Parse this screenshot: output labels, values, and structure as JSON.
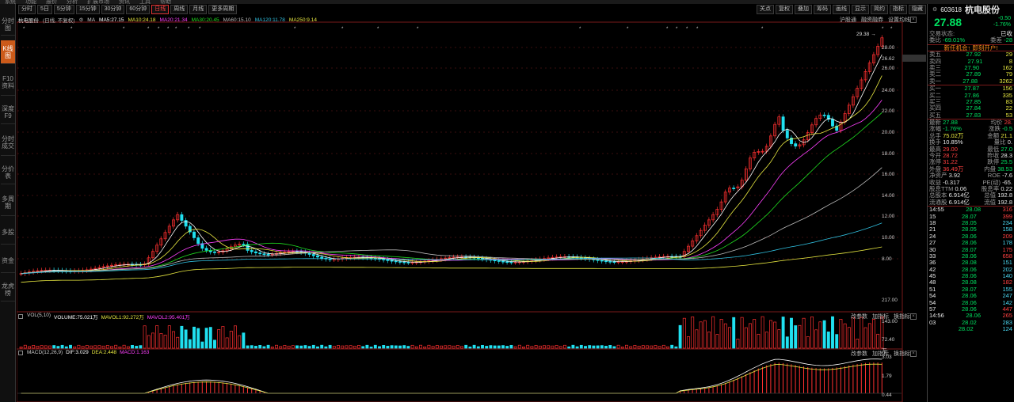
{
  "top_menu": [
    "系统",
    "功能",
    "报价",
    "分析",
    "扩展市场",
    "资讯",
    "工具",
    "帮助"
  ],
  "sidebar_tabs": [
    {
      "label": "分时图",
      "active": false
    },
    {
      "label": "K线图",
      "active": true
    },
    {
      "label": "F10资料",
      "active": false
    },
    {
      "label": "深度F9",
      "active": false
    },
    {
      "label": "分时成交",
      "active": false
    },
    {
      "label": "分价表",
      "active": false
    },
    {
      "label": "多周期",
      "active": false
    },
    {
      "label": "多股",
      "active": false
    },
    {
      "label": "资金",
      "active": false
    },
    {
      "label": "龙虎榜",
      "active": false
    }
  ],
  "toolbar": {
    "left": [
      {
        "label": "分时",
        "active": false
      },
      {
        "label": "5日",
        "active": false
      },
      {
        "label": "5分钟",
        "active": false
      },
      {
        "label": "15分钟",
        "active": false
      },
      {
        "label": "30分钟",
        "active": false
      },
      {
        "label": "60分钟",
        "active": false
      },
      {
        "label": "日线",
        "active": true
      },
      {
        "label": "周线",
        "active": false
      },
      {
        "label": "月线",
        "active": false
      },
      {
        "label": "更多周期",
        "active": false
      }
    ],
    "right": [
      "关点",
      "复权",
      "叠加",
      "筹码",
      "画线",
      "显示",
      "简约",
      "指标",
      "隐藏"
    ]
  },
  "main_panel": {
    "stock_label": "杭电股份",
    "period_note": "(日线, 不复权)",
    "legend": [
      {
        "text": "MA",
        "color": "#cccccc"
      },
      {
        "text": "MA5:27.15",
        "color": "#ffffff"
      },
      {
        "text": "MA10:24.18",
        "color": "#e8e840"
      },
      {
        "text": "MA20:21.34",
        "color": "#ff40ff"
      },
      {
        "text": "MA30:20.45",
        "color": "#20e020"
      },
      {
        "text": "MA60:15.10",
        "color": "#bbbbbb"
      },
      {
        "text": "MA120:11.78",
        "color": "#30c0e0"
      },
      {
        "text": "MA250:9.14",
        "color": "#e8e840"
      }
    ],
    "tools": [
      "沪股通",
      "融资融券",
      "设置均线"
    ],
    "max_label": "29.38",
    "price_ticks": [
      "28.00",
      "26.62",
      "26.00",
      "24.00",
      "22.00",
      "20.00",
      "18.00",
      "16.00",
      "14.00",
      "12.00",
      "10.00",
      "8.00"
    ]
  },
  "vol_panel": {
    "legend": [
      {
        "text": "VOL(5,10)",
        "color": "#cccccc"
      },
      {
        "text": "VOLUME:75.021万",
        "color": "#ffffff"
      },
      {
        "text": "MAVOL1:92.272万",
        "color": "#e8e840"
      },
      {
        "text": "MAVOL2:95.401万",
        "color": "#ff40ff"
      }
    ],
    "tools": [
      "改参数",
      "加指标",
      "换指标"
    ],
    "ticks": [
      "217.00",
      "143.00",
      "72.40",
      "万"
    ]
  },
  "macd_panel": {
    "legend": [
      {
        "text": "MACD(12,26,9)",
        "color": "#cccccc"
      },
      {
        "text": "DIF:3.029",
        "color": "#ffffff"
      },
      {
        "text": "DEA:2.448",
        "color": "#e8e840"
      },
      {
        "text": "MACD:1.163",
        "color": "#ff40ff"
      }
    ],
    "tools": [
      "改参数",
      "加指标",
      "换指标"
    ],
    "ticks": [
      "3.03",
      "1.79",
      "0.44"
    ]
  },
  "quote": {
    "code": "603618",
    "name": "杭电股份",
    "price": "27.88",
    "change": "-0.50",
    "change_pct": "-1.76%",
    "status_label": "交易状态:",
    "status_value": "已收",
    "webi_label": "委比",
    "webi_value": "-69.01%",
    "wecha_label": "委差",
    "wecha_value": "-28",
    "ad_text": "新任机会↑ 即刻开户!",
    "asks": [
      {
        "label": "卖五",
        "price": "27.92",
        "vol": "29"
      },
      {
        "label": "卖四",
        "price": "27.91",
        "vol": "8"
      },
      {
        "label": "卖三",
        "price": "27.90",
        "vol": "162"
      },
      {
        "label": "卖二",
        "price": "27.89",
        "vol": "79"
      },
      {
        "label": "卖一",
        "price": "27.88",
        "vol": "3262"
      }
    ],
    "bids": [
      {
        "label": "买一",
        "price": "27.87",
        "vol": "156"
      },
      {
        "label": "买二",
        "price": "27.86",
        "vol": "335"
      },
      {
        "label": "买三",
        "price": "27.85",
        "vol": "83"
      },
      {
        "label": "买四",
        "price": "27.84",
        "vol": "22"
      },
      {
        "label": "买五",
        "price": "27.83",
        "vol": "53"
      }
    ],
    "stats": [
      {
        "l1": "最新",
        "v1": "27.88",
        "c1": "green",
        "l2": "均价",
        "v2": "28.",
        "c2": "red"
      },
      {
        "l1": "涨幅",
        "v1": "-1.76%",
        "c1": "green",
        "l2": "涨跌",
        "v2": "-0.5",
        "c2": "green"
      },
      {
        "l1": "总手",
        "v1": "75.02万",
        "c1": "yellow",
        "l2": "金额",
        "v2": "21.1",
        "c2": "yellow"
      },
      {
        "l1": "换手",
        "v1": "10.85%",
        "c1": "white",
        "l2": "量比",
        "v2": "0.",
        "c2": "white"
      },
      {
        "l1": "最高",
        "v1": "29.00",
        "c1": "red",
        "l2": "最低",
        "v2": "27.0",
        "c2": "green"
      },
      {
        "l1": "今开",
        "v1": "28.72",
        "c1": "red",
        "l2": "昨收",
        "v2": "28.3",
        "c2": "white"
      },
      {
        "l1": "涨停",
        "v1": "31.22",
        "c1": "red",
        "l2": "跌停",
        "v2": "25.5",
        "c2": "green"
      },
      {
        "l1": "外盘",
        "v1": "36.49万",
        "c1": "red",
        "l2": "内盘",
        "v2": "38.53",
        "c2": "green"
      },
      {
        "l1": "净资产",
        "v1": "3.92",
        "c1": "white",
        "l2": "ROE",
        "v2": "-7.6",
        "c2": "white"
      },
      {
        "l1": "收益",
        "v1": "-0.317",
        "c1": "white",
        "l2": "PE(动)",
        "v2": "-65.",
        "c2": "white"
      },
      {
        "l1": "股息TTM",
        "v1": "0.06",
        "c1": "white",
        "l2": "股息率",
        "v2": "0.22",
        "c2": "white"
      },
      {
        "l1": "总股本",
        "v1": "6.914亿",
        "c1": "white",
        "l2": "总值",
        "v2": "192.8",
        "c2": "white"
      },
      {
        "l1": "流通股",
        "v1": "6.914亿",
        "c1": "white",
        "l2": "流值",
        "v2": "192.8",
        "c2": "white"
      }
    ],
    "ticks": [
      {
        "t": "14:55",
        "p": "28.08",
        "v": "316",
        "c": "red"
      },
      {
        "t": "15",
        "p": "28.07",
        "v": "399",
        "c": "red"
      },
      {
        "t": "18",
        "p": "28.05",
        "v": "234",
        "c": "cyan"
      },
      {
        "t": "21",
        "p": "28.05",
        "v": "158",
        "c": "cyan"
      },
      {
        "t": "24",
        "p": "28.06",
        "v": "209",
        "c": "red"
      },
      {
        "t": "27",
        "p": "28.06",
        "v": "178",
        "c": "cyan"
      },
      {
        "t": "30",
        "p": "28.07",
        "v": "175",
        "c": "red"
      },
      {
        "t": "33",
        "p": "28.06",
        "v": "658",
        "c": "red"
      },
      {
        "t": "36",
        "p": "28.08",
        "v": "151",
        "c": "cyan"
      },
      {
        "t": "42",
        "p": "28.06",
        "v": "202",
        "c": "cyan"
      },
      {
        "t": "45",
        "p": "28.06",
        "v": "140",
        "c": "cyan"
      },
      {
        "t": "48",
        "p": "28.08",
        "v": "182",
        "c": "red"
      },
      {
        "t": "51",
        "p": "28.07",
        "v": "155",
        "c": "cyan"
      },
      {
        "t": "54",
        "p": "28.06",
        "v": "247",
        "c": "cyan"
      },
      {
        "t": "54",
        "p": "28.06",
        "v": "142",
        "c": "cyan"
      },
      {
        "t": "57",
        "p": "28.06",
        "v": "447",
        "c": "red"
      },
      {
        "t": "14:56",
        "p": "28.06",
        "v": "265",
        "c": "red"
      },
      {
        "t": "03",
        "p": "28.02",
        "v": "283",
        "c": "cyan"
      },
      {
        "t": "",
        "p": "28.02",
        "v": "124",
        "c": "cyan"
      }
    ]
  }
}
